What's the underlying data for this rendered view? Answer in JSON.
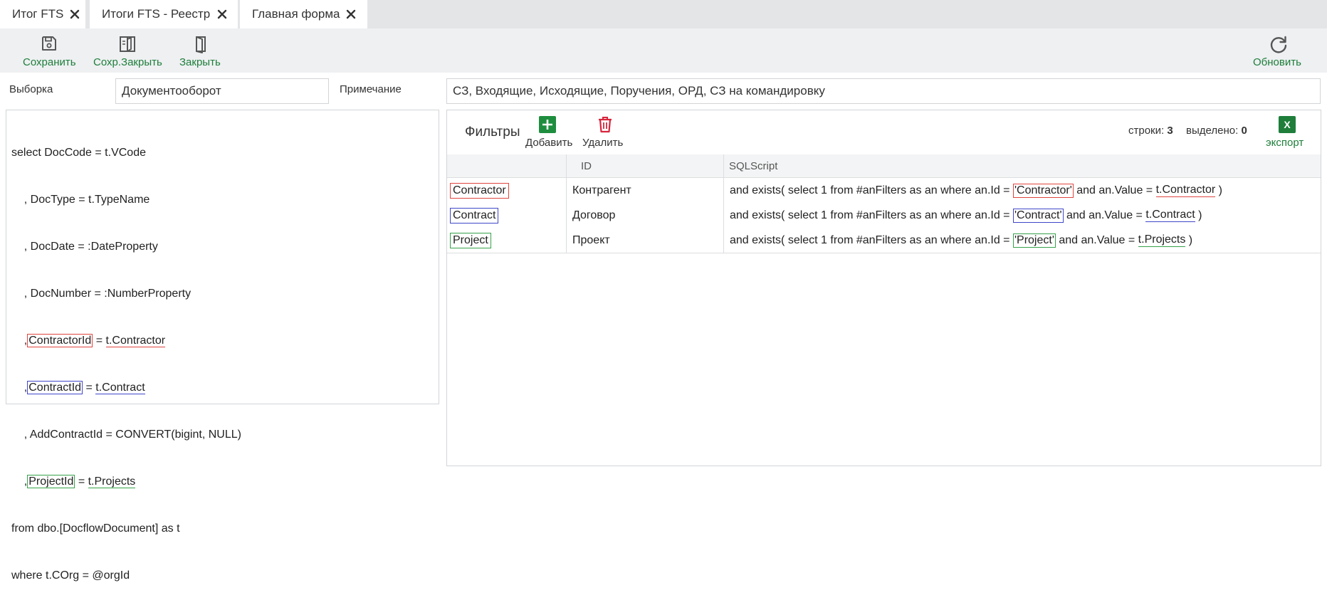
{
  "tabs": [
    {
      "label": "Итог FTS"
    },
    {
      "label": "Итоги FTS - Реестр"
    },
    {
      "label": "Главная форма"
    }
  ],
  "toolbar": {
    "save_label": "Сохранить",
    "save_close_label": "Сохр.Закрыть",
    "close_label": "Закрыть",
    "refresh_label": "Обновить",
    "accent_color": "#1e7e3a"
  },
  "form": {
    "selection_label": "Выборка",
    "selection_value": "Документооборот",
    "note_label": "Примечание",
    "note_value": "СЗ, Входящие, Исходящие, Поручения, ОРД, СЗ на командировку"
  },
  "sql": {
    "l1": "select DocCode = t.VCode",
    "l2": "    , DocType = t.TypeName",
    "l3": "    , DocDate = :DateProperty",
    "l4": "    , DocNumber = :NumberProperty",
    "l5_pre": "    ,",
    "l5_key": "ContractorId",
    "l5_mid": " = ",
    "l5_val": "t.Contractor",
    "l6_pre": "    ,",
    "l6_key": "ContractId",
    "l6_mid": " = ",
    "l6_val": "t.Contract",
    "l7": "    , AddContractId = CONVERT(bigint, NULL)",
    "l8_pre": "    ,",
    "l8_key": "ProjectId",
    "l8_mid": " = ",
    "l8_val": "t.Projects",
    "l9": "from dbo.[DocflowDocument] as t",
    "l10": "where t.COrg = @orgId"
  },
  "filters": {
    "title": "Фильтры",
    "add_label": "Добавить",
    "delete_label": "Удалить",
    "rows_label": "строки:",
    "rows_count": "3",
    "selected_label": "выделено:",
    "selected_count": "0",
    "export_label": "экспорт",
    "export_icon_text": "X",
    "columns": [
      "",
      "ID",
      "SQLScript"
    ],
    "rows": [
      {
        "key": "Contractor",
        "id": "Контрагент",
        "script_pre": "and exists( select 1 from #anFilters as an where an.Id = ",
        "script_key": "'Contractor'",
        "script_mid": " and an.Value = ",
        "script_val": "t.Contractor",
        "script_post": " )",
        "color": "red"
      },
      {
        "key": "Contract",
        "id": "Договор",
        "script_pre": "and exists( select 1 from #anFilters as an where an.Id = ",
        "script_key": "'Contract'",
        "script_mid": " and an.Value = ",
        "script_val": "t.Contract",
        "script_post": " )",
        "color": "blue"
      },
      {
        "key": "Project",
        "id": "Проект",
        "script_pre": "and exists( select 1 from #anFilters as an where an.Id = ",
        "script_key": "'Project'",
        "script_mid": " and an.Value = ",
        "script_val": "t.Projects",
        "script_post": " )",
        "color": "green"
      }
    ]
  },
  "colors": {
    "red": "#e0453f",
    "blue": "#3f47c9",
    "green": "#36a24a",
    "delete": "#d7263d",
    "add": "#1e8e3e"
  }
}
